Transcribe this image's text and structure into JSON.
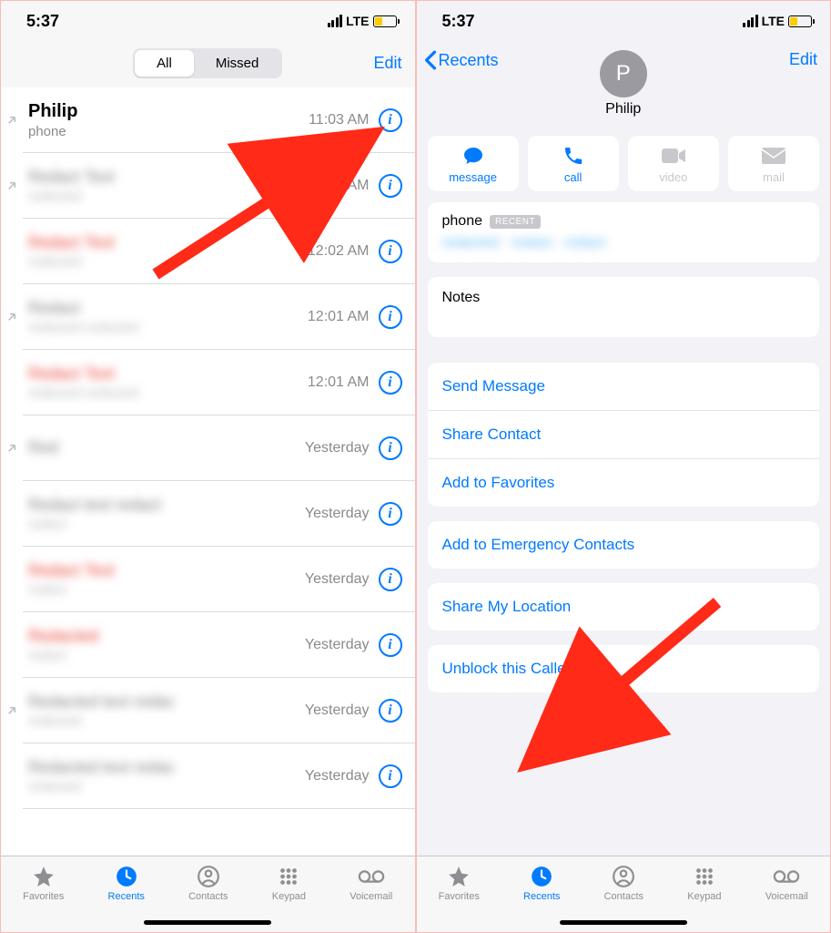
{
  "status": {
    "time": "5:37",
    "network": "LTE"
  },
  "left": {
    "segmented": {
      "all": "All",
      "missed": "Missed"
    },
    "edit": "Edit",
    "rows": [
      {
        "name": "Philip",
        "sub": "phone",
        "time": "11:03 AM",
        "missed": false,
        "ct": "out"
      },
      {
        "name": "Redact Text",
        "sub": "redacted",
        "time": "12:02 AM",
        "missed": false,
        "ct": "out"
      },
      {
        "name": "Redact Text",
        "sub": "redacted",
        "time": "12:02 AM",
        "missed": true,
        "ct": ""
      },
      {
        "name": "Redact",
        "sub": "redacted redacted",
        "time": "12:01 AM",
        "missed": false,
        "ct": "out"
      },
      {
        "name": "Redact Text",
        "sub": "redacted redacted",
        "time": "12:01 AM",
        "missed": true,
        "ct": ""
      },
      {
        "name": "Red",
        "sub": "",
        "time": "Yesterday",
        "missed": false,
        "ct": "out"
      },
      {
        "name": "Redact text redact",
        "sub": "redact",
        "time": "Yesterday",
        "missed": false,
        "ct": ""
      },
      {
        "name": "Redact Text",
        "sub": "redact",
        "time": "Yesterday",
        "missed": true,
        "ct": ""
      },
      {
        "name": "Redacted",
        "sub": "redact",
        "time": "Yesterday",
        "missed": true,
        "ct": ""
      },
      {
        "name": "Redacted text redac",
        "sub": "redacted",
        "time": "Yesterday",
        "missed": false,
        "ct": "out"
      },
      {
        "name": "Redacted text redac",
        "sub": "redacted",
        "time": "Yesterday",
        "missed": false,
        "ct": ""
      }
    ]
  },
  "right": {
    "back": "Recents",
    "edit": "Edit",
    "initial": "P",
    "name": "Philip",
    "actions": {
      "message": "message",
      "call": "call",
      "video": "video",
      "mail": "mail"
    },
    "phone": {
      "label": "phone",
      "badge": "RECENT",
      "number": "redacted · redact · redact"
    },
    "notes": "Notes",
    "links1": [
      "Send Message",
      "Share Contact",
      "Add to Favorites"
    ],
    "links2": [
      "Add to Emergency Contacts"
    ],
    "links3": [
      "Share My Location"
    ],
    "links4": [
      "Unblock this Caller"
    ]
  },
  "tabs": {
    "favorites": "Favorites",
    "recents": "Recents",
    "contacts": "Contacts",
    "keypad": "Keypad",
    "voicemail": "Voicemail"
  }
}
